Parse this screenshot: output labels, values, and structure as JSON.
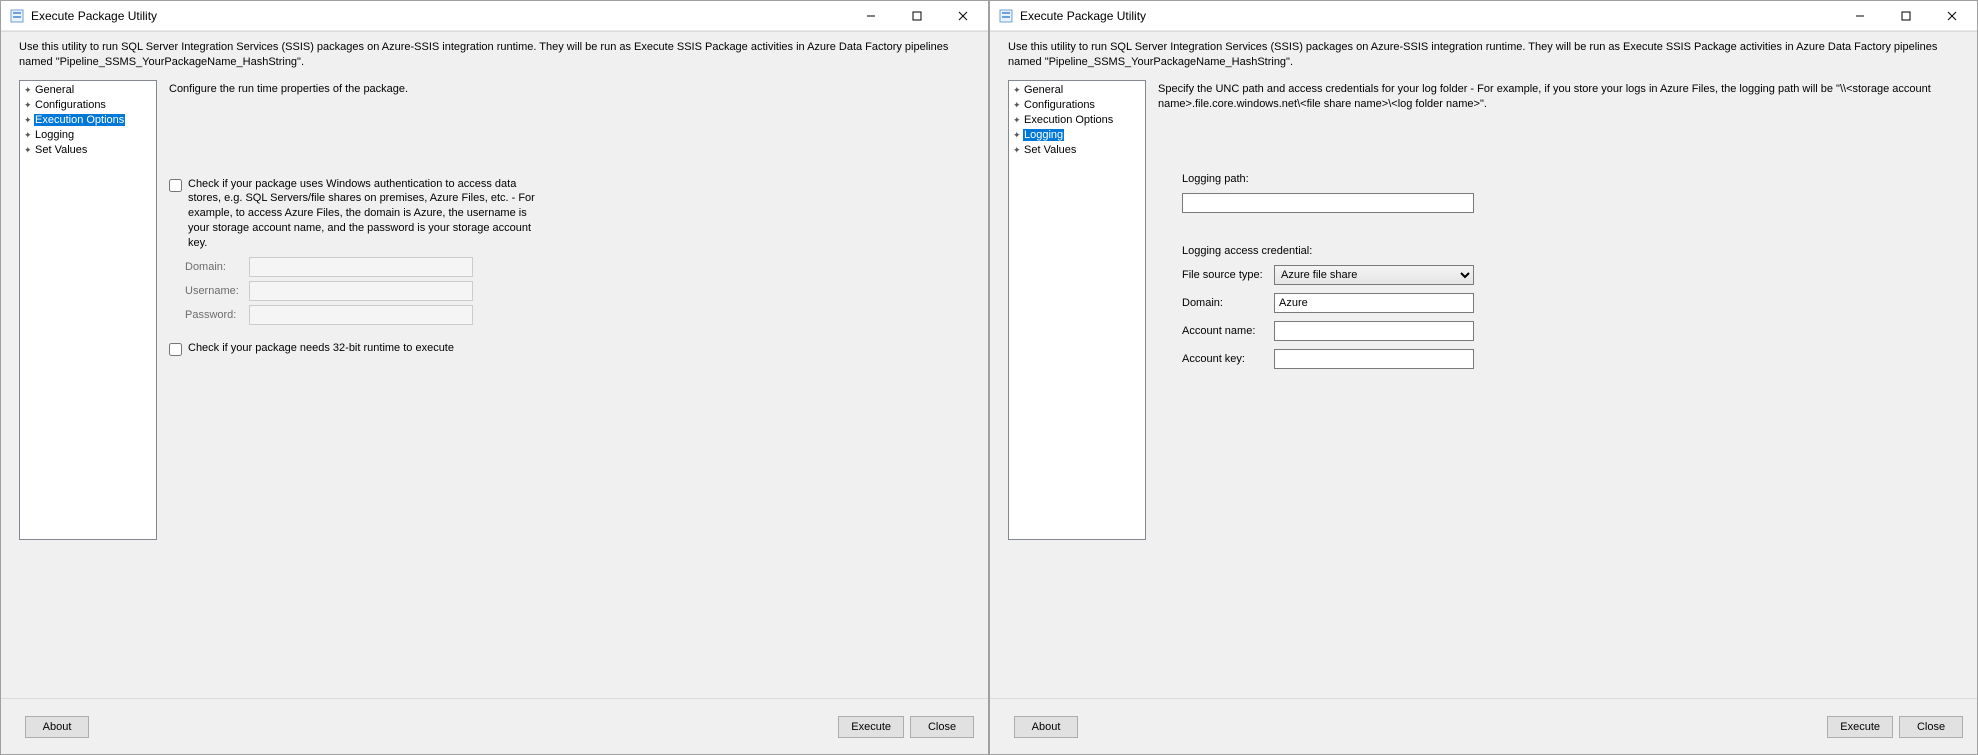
{
  "windowLeft": {
    "title": "Execute Package Utility",
    "description": "Use this utility to run SQL Server Integration Services (SSIS) packages on Azure-SSIS integration runtime. They will be run as Execute SSIS Package activities in Azure Data Factory pipelines named \"Pipeline_SSMS_YourPackageName_HashString\".",
    "nav": {
      "items": [
        "General",
        "Configurations",
        "Execution Options",
        "Logging",
        "Set Values"
      ],
      "selected": "Execution Options"
    },
    "pane": {
      "header": "Configure the run time properties of the package.",
      "cb1": "Check if your package uses Windows authentication to access data stores, e.g. SQL Servers/file shares on premises, Azure Files, etc. - For example, to access Azure Files, the domain is Azure, the username is your storage account name, and the password is your storage account key.",
      "domainLabel": "Domain:",
      "domainValue": "",
      "usernameLabel": "Username:",
      "usernameValue": "",
      "passwordLabel": "Password:",
      "passwordValue": "",
      "cb2": "Check if your package needs 32-bit runtime to execute"
    },
    "footer": {
      "about": "About",
      "execute": "Execute",
      "close": "Close"
    }
  },
  "windowRight": {
    "title": "Execute Package Utility",
    "description": "Use this utility to run SQL Server Integration Services (SSIS) packages on Azure-SSIS integration runtime. They will be run as Execute SSIS Package activities in Azure Data Factory pipelines named \"Pipeline_SSMS_YourPackageName_HashString\".",
    "nav": {
      "items": [
        "General",
        "Configurations",
        "Execution Options",
        "Logging",
        "Set Values"
      ],
      "selected": "Logging"
    },
    "pane": {
      "header": "Specify the UNC path and access credentials for your log folder - For example, if you store your logs in Azure Files, the logging path will be \"\\\\<storage account name>.file.core.windows.net\\<file share name>\\<log folder name>\".",
      "loggingPathLabel": "Logging path:",
      "loggingPathValue": "",
      "credHeader": "Logging access credential:",
      "fileSourceLabel": "File source type:",
      "fileSourceValue": "Azure file share",
      "domainLabel": "Domain:",
      "domainValue": "Azure",
      "accountNameLabel": "Account name:",
      "accountNameValue": "",
      "accountKeyLabel": "Account key:",
      "accountKeyValue": ""
    },
    "footer": {
      "about": "About",
      "execute": "Execute",
      "close": "Close"
    }
  }
}
